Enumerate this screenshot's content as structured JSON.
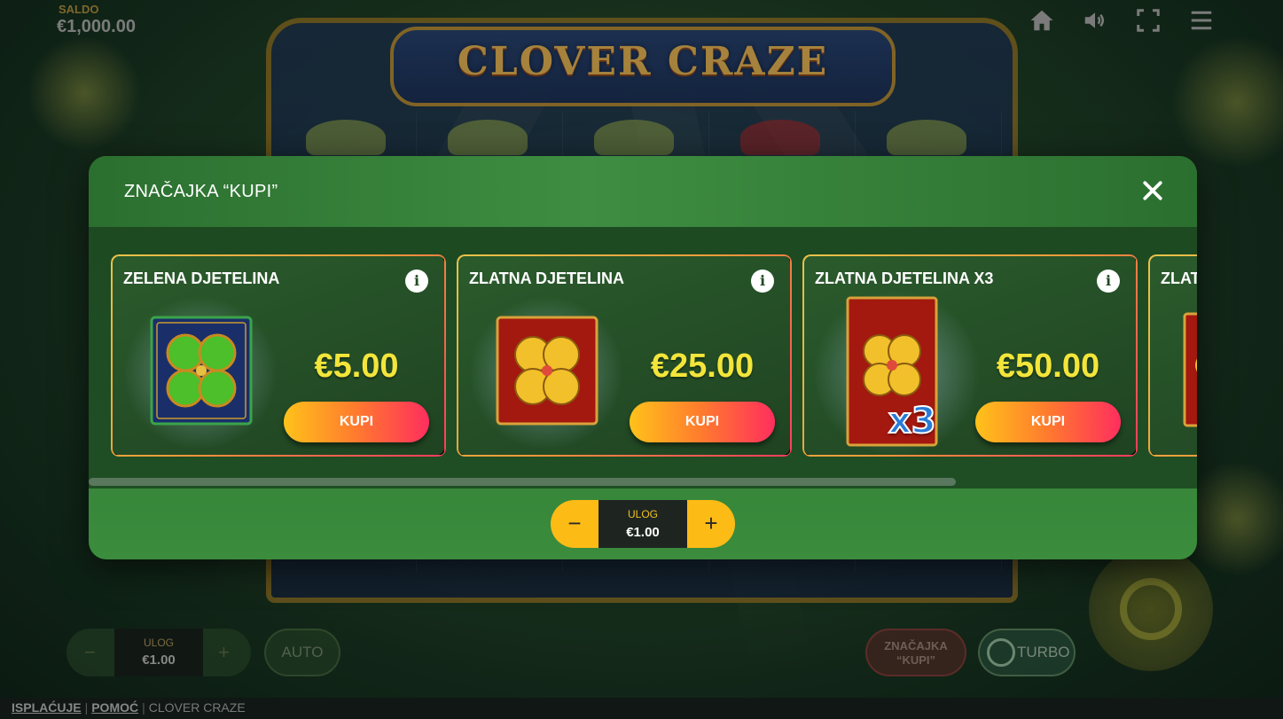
{
  "game": {
    "title": "CLOVER CRAZE",
    "saldo_label": "SALDO",
    "saldo_value": "€1,000.00"
  },
  "top_icons": [
    "home-icon",
    "sound-icon",
    "fullscreen-icon",
    "menu-icon"
  ],
  "modal": {
    "title": "ZNAČAJKA “KUPI”",
    "cards": [
      {
        "title": "ZELENA DJETELINA",
        "price": "€5.00",
        "button": "KUPI",
        "info": "i",
        "symbol": "green-clover"
      },
      {
        "title": "ZLATNA DJETELINA",
        "price": "€25.00",
        "button": "KUPI",
        "info": "i",
        "symbol": "gold-clover"
      },
      {
        "title": "ZLATNA DJETELINA X3",
        "price": "€50.00",
        "button": "KUPI",
        "info": "i",
        "symbol": "gold-clover-x3",
        "multiplier": "x3"
      },
      {
        "title": "ZLATNA DJETELINA",
        "price": "",
        "button": "",
        "info": "",
        "symbol": "gold-clover"
      }
    ],
    "stake": {
      "label": "ULOG",
      "value": "€1.00",
      "minus": "−",
      "plus": "+"
    }
  },
  "bottom_bar": {
    "stake_label": "ULOG",
    "stake_value": "€1.00",
    "stake_minus": "−",
    "stake_plus": "+",
    "auto": "AUTO",
    "buy_feature_line1": "ZNAČAJKA",
    "buy_feature_line2": "“KUPI”",
    "turbo": "TURBO"
  },
  "footer": {
    "payouts": "ISPLAĆUJE",
    "help": "POMOĆ",
    "game_name": "CLOVER CRAZE",
    "separator": "|"
  },
  "colors": {
    "price": "#f3e53a",
    "buy_button_start": "#ffc21a",
    "buy_button_end": "#ff2e5e",
    "stake_accent": "#fdbb16",
    "modal_green": "#2f7a33"
  }
}
